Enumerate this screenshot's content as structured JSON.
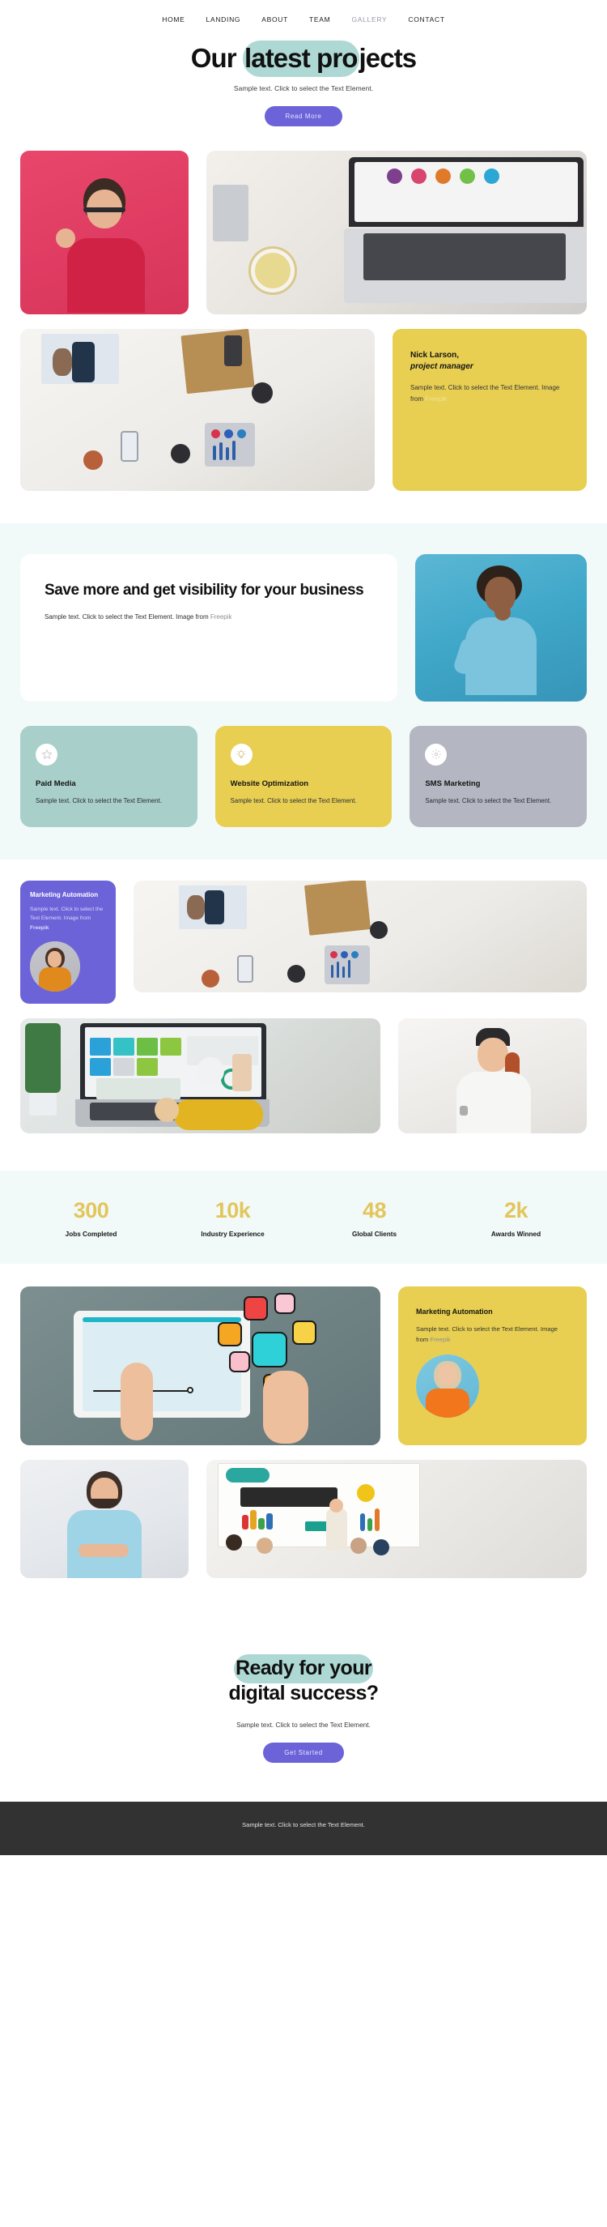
{
  "nav": {
    "items": [
      {
        "label": "HOME",
        "active": false
      },
      {
        "label": "LANDING",
        "active": false
      },
      {
        "label": "ABOUT",
        "active": false
      },
      {
        "label": "TEAM",
        "active": false
      },
      {
        "label": "GALLERY",
        "active": true
      },
      {
        "label": "CONTACT",
        "active": false
      }
    ]
  },
  "hero": {
    "title_pre": "Our ",
    "title_highlight": "latest pro",
    "title_post": "jects",
    "subtitle": "Sample text. Click to select the Text Element.",
    "button": "Read More",
    "highlight_color": "#aed8d4",
    "button_color": "#6c63d8"
  },
  "gallery": {
    "image_1_alt": "man-in-red-sweater-ok-gesture",
    "image_2_alt": "hands-typing-on-laptop-with-marketing-icons",
    "image_3_alt": "team-meeting-top-view-with-phones-and-charts",
    "testimonial": {
      "name": "Nick Larson,",
      "role": "project manager",
      "text": "Sample text. Click to select the Text Element. Image from ",
      "credit": "Freepik",
      "bg": "#e8cf52"
    }
  },
  "savemore": {
    "heading": "Save more and get visibility for your business",
    "text": "Sample text. Click to select the Text Element. Image from ",
    "credit": "Freepik",
    "image_alt": "smiling-woman-in-blue-turtleneck",
    "section_bg": "#f2f9f9"
  },
  "services": [
    {
      "icon": "star-icon",
      "title": "Paid Media",
      "text": "Sample text. Click to select the Text Element.",
      "bg": "#a8cfc9"
    },
    {
      "icon": "lightbulb-icon",
      "title": "Website Optimization",
      "text": "Sample text. Click to select the Text Element.",
      "bg": "#e8cf52"
    },
    {
      "icon": "gear-icon",
      "title": "SMS Marketing",
      "text": "Sample text. Click to select the Text Element.",
      "bg": "#b4b7c1"
    }
  ],
  "automation_purple": {
    "title": "Marketing Automation",
    "text": "Sample text. Click to select the Text Element. Image from ",
    "credit": "Freepik",
    "bg": "#6c63d8",
    "avatar_alt": "woman-in-orange-top"
  },
  "blocks": {
    "image_meeting_alt": "team-meeting-top-view-phones-tablet",
    "image_dashboard_alt": "hands-typing-laptop-analytics-dashboard",
    "image_woman_beanie_alt": "smiling-woman-with-beanie-and-braid"
  },
  "stats": [
    {
      "value": "300",
      "label": "Jobs Completed"
    },
    {
      "value": "10k",
      "label": "Industry Experience"
    },
    {
      "value": "48",
      "label": "Global Clients"
    },
    {
      "value": "2k",
      "label": "Awards Winned"
    }
  ],
  "stats_color": "#e2c65a",
  "automation_yellow": {
    "title": "Marketing Automation",
    "text": "Sample text. Click to select the Text Element. Image from ",
    "credit": "Freepik",
    "bg": "#e8cf52",
    "avatar_alt": "blonde-woman-in-orange-sweater"
  },
  "gallery2": {
    "image_digital_media_alt": "hand-holding-tablet-digital-media",
    "image_bearded_man_alt": "bearded-man-in-blue-polo-arms-crossed",
    "image_commerce_alt": "presentation-commerce-teamwork-whiteboard"
  },
  "cta": {
    "line1": "Ready for your",
    "line2": "digital success?",
    "subtitle": "Sample text. Click to select the Text Element.",
    "button": "Get Started"
  },
  "footer": {
    "text": "Sample text. Click to select the Text Element.",
    "bg": "#323232"
  }
}
